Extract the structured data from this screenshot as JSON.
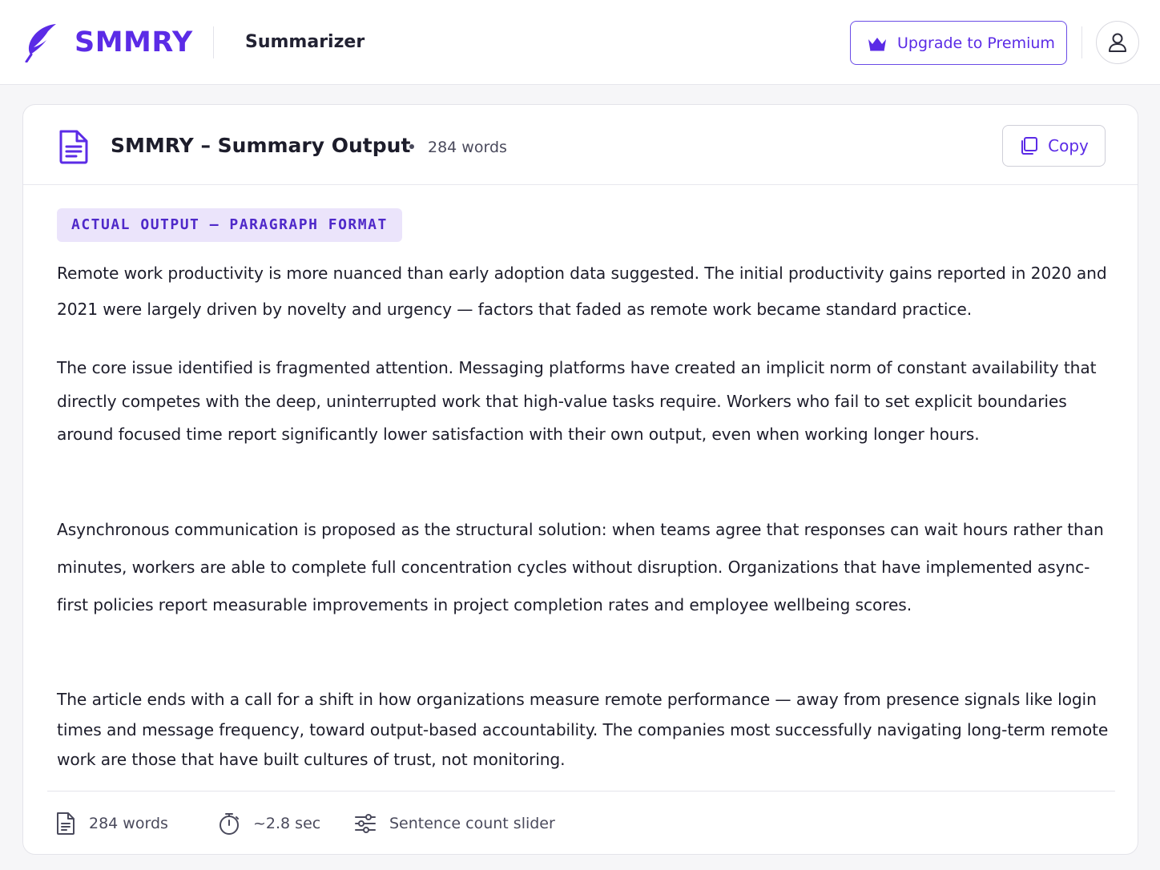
{
  "header": {
    "brand": "SMMRY",
    "app_name": "Summarizer",
    "upgrade_label": "Upgrade to Premium",
    "icons": {
      "logo": "feather-icon",
      "upgrade": "crown-icon",
      "user": "user-icon"
    }
  },
  "card": {
    "title": "SMMRY – Summary Output",
    "word_count": "284 words",
    "copy_label": "Copy",
    "format_badge": "ACTUAL OUTPUT – PARAGRAPH FORMAT",
    "paragraphs": [
      "Remote work productivity is more nuanced than early adoption data suggested. The initial productivity gains reported in 2020 and 2021 were largely driven by novelty and urgency — factors that faded as remote work became standard practice.",
      "The core issue identified is fragmented attention. Messaging platforms have created an implicit norm of constant availability that directly competes with the deep, uninterrupted work that high-value tasks require. Workers who fail to set explicit boundaries around focused time report significantly lower satisfaction with their own output, even when working longer hours.",
      "Asynchronous communication is proposed as the structural solution: when teams agree that responses can wait hours rather than minutes, workers are able to complete full concentration cycles without disruption. Organizations that have implemented async-first policies report measurable improvements in project completion rates and employee wellbeing scores.",
      "The article ends with a call for a shift in how organizations measure remote performance — away from presence signals like login times and message frequency, toward output-based accountability. The companies most successfully navigating long-term remote work are those that have built cultures of trust, not monitoring."
    ],
    "footer": {
      "words": "284 words",
      "time": "~2.8 sec",
      "slider": "Sentence count slider"
    }
  },
  "colors": {
    "accent": "#5b2be6",
    "badge_bg": "#ebe4fb",
    "text": "#1d1d2b",
    "muted": "#4a4a5c"
  }
}
